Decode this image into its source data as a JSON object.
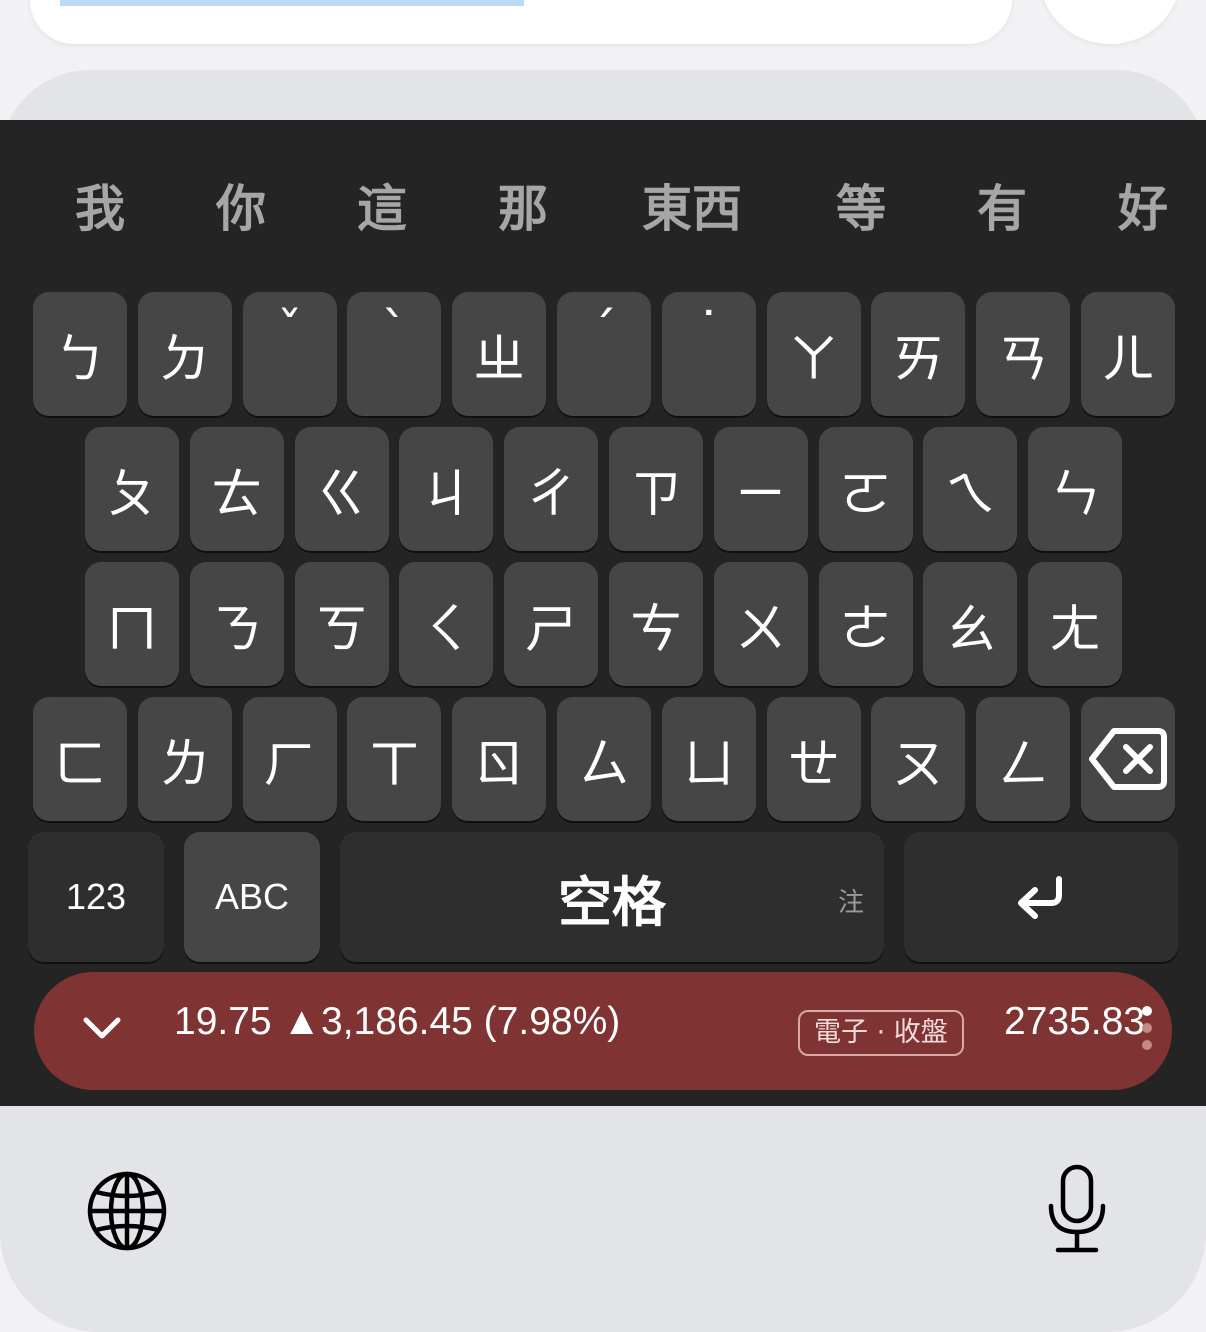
{
  "candidates": [
    "我",
    "你",
    "這",
    "那",
    "東西",
    "等",
    "有",
    "好"
  ],
  "rows": {
    "row1": [
      "ㄅ",
      "ㄉ",
      "ˇ",
      "ˋ",
      "ㄓ",
      "ˊ",
      "˙",
      "ㄚ",
      "ㄞ",
      "ㄢ",
      "ㄦ"
    ],
    "row2": [
      "ㄆ",
      "ㄊ",
      "ㄍ",
      "ㄐ",
      "ㄔ",
      "ㄗ",
      "ㄧ",
      "ㄛ",
      "ㄟ",
      "ㄣ"
    ],
    "row3": [
      "ㄇ",
      "ㄋ",
      "ㄎ",
      "ㄑ",
      "ㄕ",
      "ㄘ",
      "ㄨ",
      "ㄜ",
      "ㄠ",
      "ㄤ"
    ],
    "row4": [
      "ㄈ",
      "ㄌ",
      "ㄏ",
      "ㄒ",
      "ㄖ",
      "ㄙ",
      "ㄩ",
      "ㄝ",
      "ㄡ",
      "ㄥ"
    ]
  },
  "bottom": {
    "numbers_label": "123",
    "abc_label": "ABC",
    "space_label": "空格",
    "space_sublabel": "注"
  },
  "icons": {
    "delete": "delete-backward-icon",
    "return": "return-icon",
    "globe": "globe-icon",
    "mic": "microphone-icon",
    "collapse": "chevron-down-icon"
  },
  "ticker": {
    "main_text": "19.75 ▲3,186.45 (7.98%)",
    "tag": "電子 · 收盤",
    "value": "2735.83",
    "background_color": "#7f3332"
  }
}
